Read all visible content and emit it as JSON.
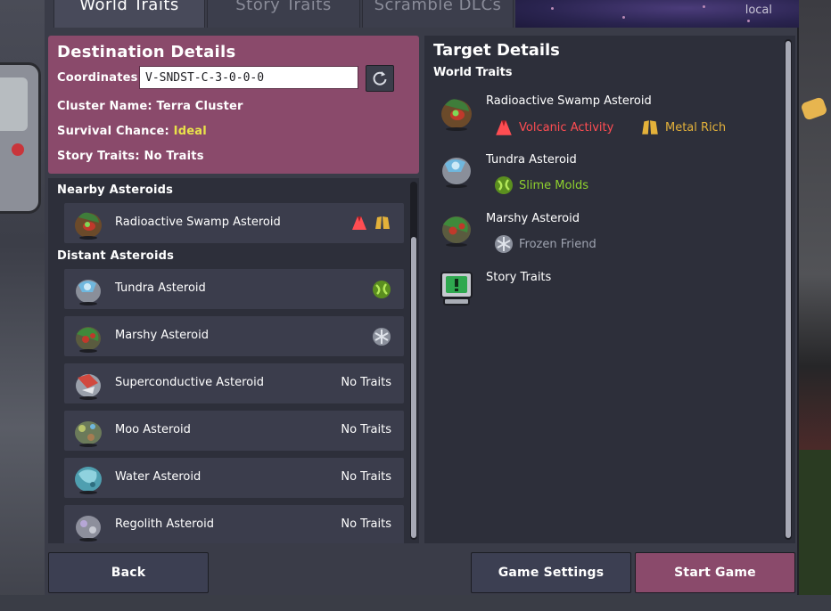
{
  "tabs": [
    {
      "label": "World Traits",
      "active": true
    },
    {
      "label": "Story Traits",
      "active": false
    },
    {
      "label": "Scramble DLCs",
      "active": false
    }
  ],
  "tab_banner_text": "local",
  "destination": {
    "title": "Destination Details",
    "coordinates_label": "Coordinates:",
    "coordinates_value": "V-SNDST-C-3-0-0-0",
    "cluster_name_label": "Cluster Name:",
    "cluster_name_value": "Terra Cluster",
    "survival_label": "Survival Chance:",
    "survival_value": "Ideal",
    "story_label": "Story Traits:",
    "story_value": "No Traits"
  },
  "nearby": {
    "title": "Nearby Asteroids",
    "items": [
      {
        "name": "Radioactive Swamp Asteroid",
        "icon": "radioactive-swamp-asteroid-icon",
        "trait_icons": [
          "volcanic-activity-icon",
          "metal-rich-icon"
        ]
      }
    ]
  },
  "distant": {
    "title": "Distant Asteroids",
    "items": [
      {
        "name": "Tundra Asteroid",
        "icon": "tundra-asteroid-icon",
        "trait_icons": [
          "slime-molds-icon"
        ],
        "traits_text": ""
      },
      {
        "name": "Marshy Asteroid",
        "icon": "marshy-asteroid-icon",
        "trait_icons": [
          "frozen-friend-icon"
        ],
        "traits_text": ""
      },
      {
        "name": "Superconductive Asteroid",
        "icon": "superconductive-asteroid-icon",
        "trait_icons": [],
        "traits_text": "No Traits"
      },
      {
        "name": "Moo Asteroid",
        "icon": "moo-asteroid-icon",
        "trait_icons": [],
        "traits_text": "No Traits"
      },
      {
        "name": "Water Asteroid",
        "icon": "water-asteroid-icon",
        "trait_icons": [],
        "traits_text": "No Traits"
      },
      {
        "name": "Regolith Asteroid",
        "icon": "regolith-asteroid-icon",
        "trait_icons": [],
        "traits_text": "No Traits"
      }
    ]
  },
  "target": {
    "title": "Target Details",
    "world_traits_title": "World Traits",
    "asteroids": [
      {
        "name": "Radioactive Swamp Asteroid",
        "traits": [
          {
            "label": "Volcanic Activity",
            "color": "#ff4d52",
            "icon": "volcanic-activity-icon"
          },
          {
            "label": "Metal Rich",
            "color": "#e3b13a",
            "icon": "metal-rich-icon"
          }
        ]
      },
      {
        "name": "Tundra Asteroid",
        "traits": [
          {
            "label": "Slime Molds",
            "color": "#8fd12e",
            "icon": "slime-molds-icon"
          }
        ]
      },
      {
        "name": "Marshy Asteroid",
        "traits": [
          {
            "label": "Frozen Friend",
            "color": "#9ea3b0",
            "icon": "frozen-friend-icon"
          }
        ]
      }
    ],
    "story_traits_label": "Story Traits"
  },
  "buttons": {
    "back": "Back",
    "game_settings": "Game Settings",
    "start_game": "Start Game"
  },
  "colors": {
    "accent": "#8a4a6b",
    "ideal": "#e9e24a",
    "panel": "#2d2f3a",
    "row": "#3b3d4c"
  }
}
